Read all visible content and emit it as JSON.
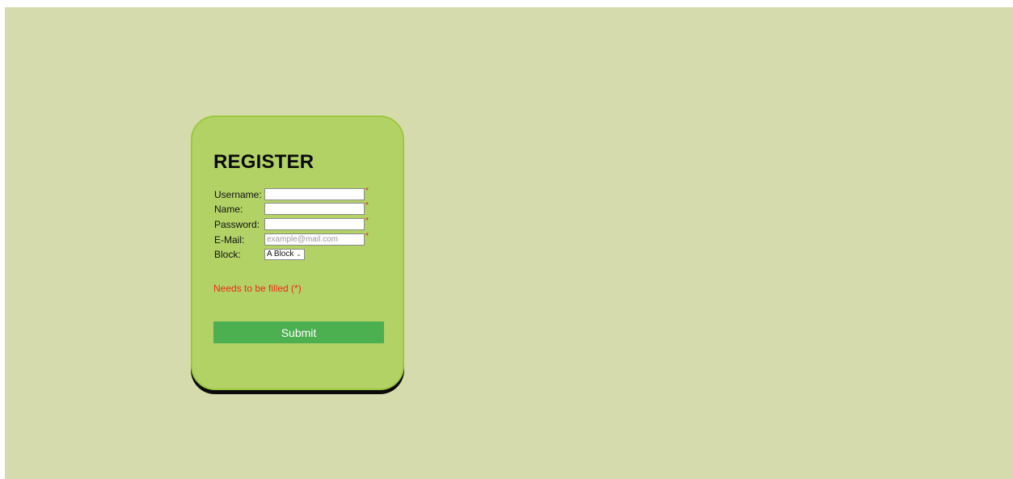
{
  "form": {
    "title": "REGISTER",
    "fields": [
      {
        "label": "Username:",
        "value": "",
        "placeholder": "",
        "required": true
      },
      {
        "label": "Name:",
        "value": "",
        "placeholder": "",
        "required": true
      },
      {
        "label": "Password:",
        "value": "",
        "placeholder": "",
        "required": true
      },
      {
        "label": "E-Mail:",
        "value": "",
        "placeholder": "example@mail.com",
        "required": true
      }
    ],
    "required_marker": "*",
    "block": {
      "label": "Block:",
      "selected": "A Block"
    },
    "required_note": "Needs to be filled (*)",
    "submit_label": "Submit"
  },
  "colors": {
    "page_background": "#d5dbad",
    "card_background": "#b2d266",
    "card_border": "#9cc83e",
    "submit_background": "#4caf50",
    "required_text": "#ee2a17"
  },
  "icons": {
    "select_arrow": "chevron-down-icon"
  }
}
